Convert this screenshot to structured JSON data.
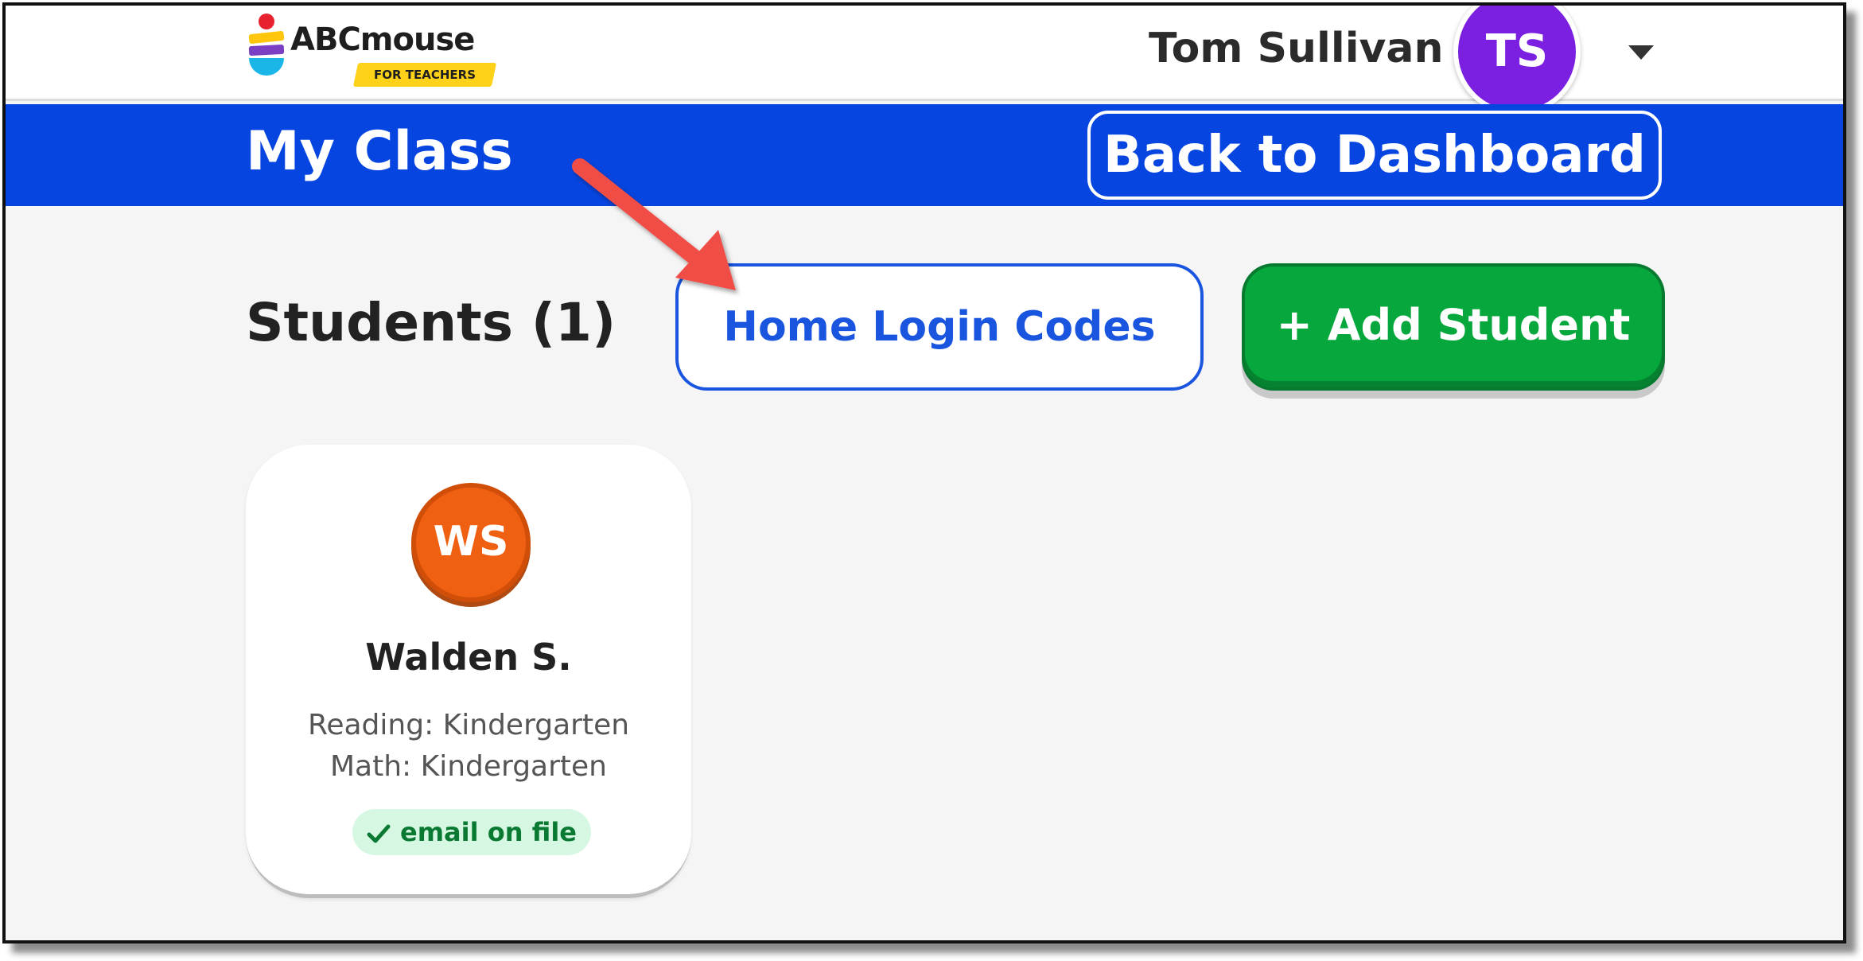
{
  "header": {
    "logo_text": "ABCmouse",
    "logo_subtext": "FOR TEACHERS",
    "user_name": "Tom Sullivan",
    "user_initials": "TS"
  },
  "nav": {
    "page_title": "My Class",
    "back_button": "Back to Dashboard"
  },
  "students": {
    "heading": "Students (1)",
    "home_login_codes_button": "Home Login Codes",
    "add_student_button": "+ Add Student",
    "list": [
      {
        "initials": "WS",
        "name": "Walden S.",
        "reading": "Reading: Kindergarten",
        "math": "Math: Kindergarten",
        "badge": "email on file"
      }
    ]
  },
  "colors": {
    "blue_bar": "#0645e0",
    "avatar_purple": "#7b1fe0",
    "add_green": "#06a83d",
    "student_orange": "#f06012",
    "arrow_red": "#ef4e45"
  }
}
